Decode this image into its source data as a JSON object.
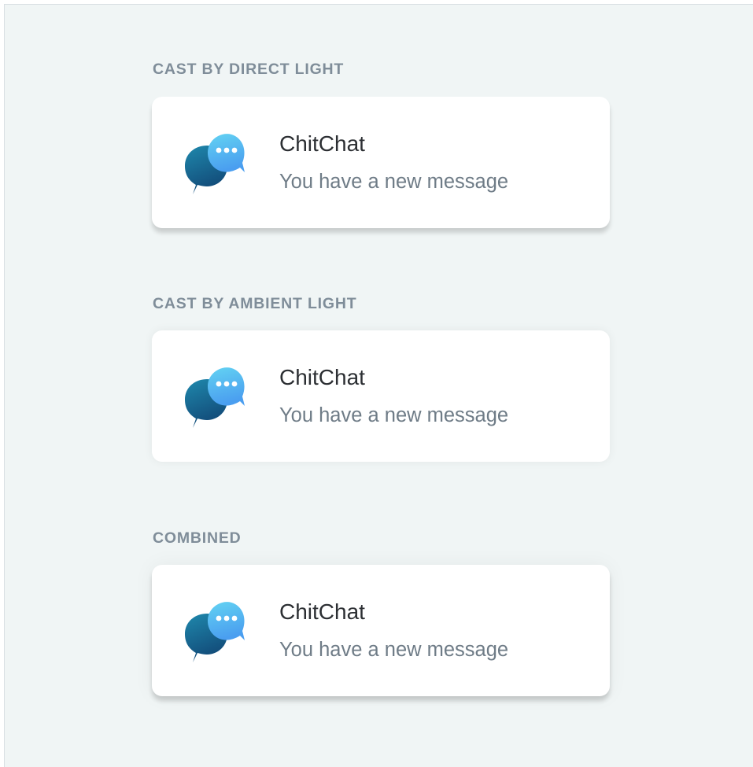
{
  "sections": [
    {
      "label": "CAST BY DIRECT LIGHT",
      "notification": {
        "icon": "chat-bubbles-icon",
        "app_name": "ChitChat",
        "message": "You have a new message"
      }
    },
    {
      "label": "CAST BY AMBIENT LIGHT",
      "notification": {
        "icon": "chat-bubbles-icon",
        "app_name": "ChitChat",
        "message": "You have a new message"
      }
    },
    {
      "label": "COMBINED",
      "notification": {
        "icon": "chat-bubbles-icon",
        "app_name": "ChitChat",
        "message": "You have a new message"
      }
    }
  ],
  "colors": {
    "background": "#f0f5f5",
    "card": "#ffffff",
    "label": "#7f8d99",
    "title": "#2c2f33",
    "message": "#6f7c87",
    "icon_front_light": "#63d3f2",
    "icon_front_dark": "#4a9ef0",
    "icon_back_light": "#1f89ad",
    "icon_back_dark": "#124a78"
  }
}
